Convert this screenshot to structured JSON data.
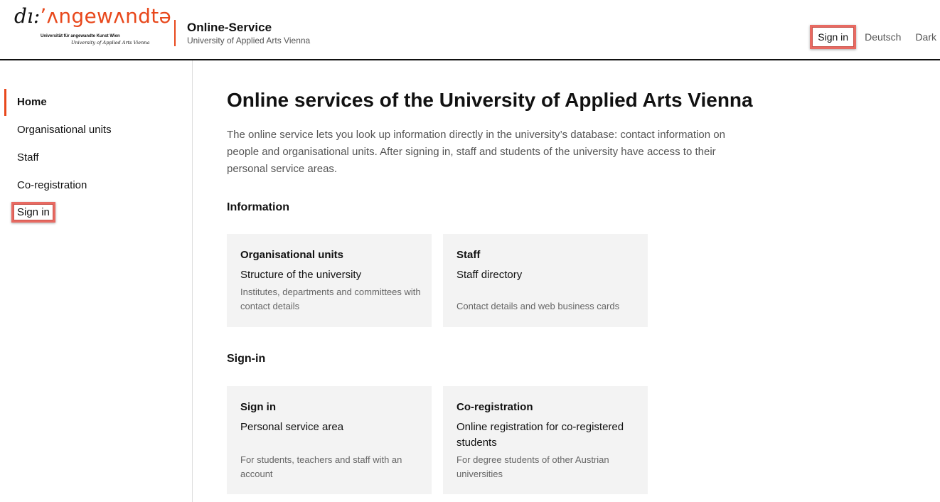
{
  "header": {
    "logo_prefix": "dı:",
    "logo_name": "ʼʌngewʌndtə",
    "logo_sub_de": "Universität für angewandte Kunst Wien",
    "logo_sub_en": "University of Applied Arts Vienna",
    "site_title": "Online-Service",
    "site_subtitle": "University of Applied Arts Vienna",
    "nav": {
      "sign_in": "Sign in",
      "language": "Deutsch",
      "theme": "Dark"
    }
  },
  "sidebar": {
    "items": [
      {
        "label": "Home",
        "active": true
      },
      {
        "label": "Organisational units"
      },
      {
        "label": "Staff"
      },
      {
        "label": "Co-registration"
      },
      {
        "label": "Sign in"
      }
    ]
  },
  "main": {
    "title": "Online services of the University of Applied Arts Vienna",
    "intro": "The online service lets you look up information directly in the university’s database: contact information on people and organisational units. After signing in, staff and students of the university have access to their personal service areas.",
    "sections": [
      {
        "heading": "Information",
        "cards": [
          {
            "title": "Organisational units",
            "subtitle": "Structure of the university",
            "description": "Institutes, departments and committees with contact details"
          },
          {
            "title": "Staff",
            "subtitle": "Staff directory",
            "description": "Contact details and web business cards"
          }
        ]
      },
      {
        "heading": "Sign-in",
        "cards": [
          {
            "title": "Sign in",
            "subtitle": "Personal service area",
            "description": "For students, teachers and staff with an account"
          },
          {
            "title": "Co-registration",
            "subtitle": "Online registration for co-registered students",
            "description": "For degree students of other Austrian universities"
          }
        ]
      }
    ]
  },
  "colors": {
    "accent": "#e8481c",
    "highlight_box": "#e86a62",
    "card_bg": "#f3f3f3"
  }
}
